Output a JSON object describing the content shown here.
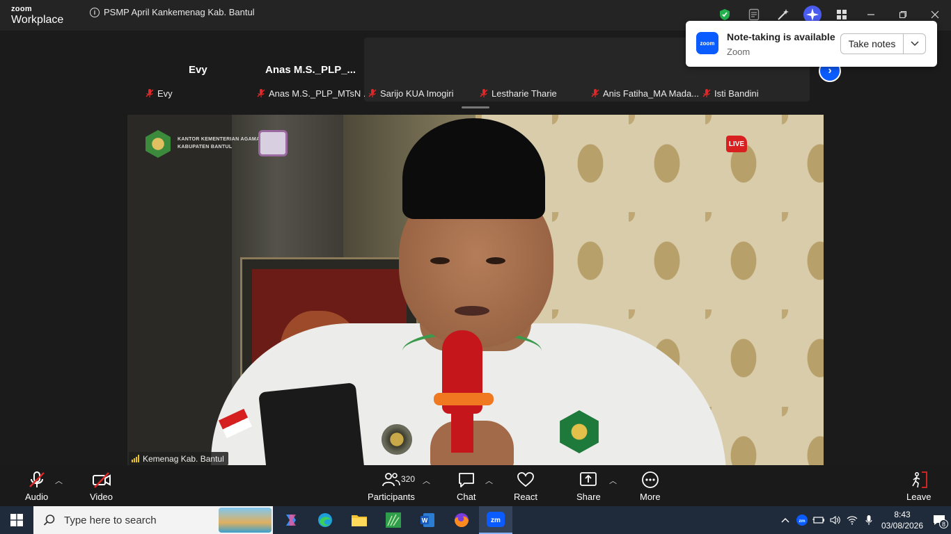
{
  "titlebar": {
    "brand_small": "zoom",
    "brand_large": "Workplace",
    "meeting_title": "PSMP April Kankemenag Kab. Bantul"
  },
  "gallery": {
    "names": [
      "Evy",
      "Anas  M.S._PLP_..."
    ],
    "tiles": [
      {
        "label": "Evy"
      },
      {
        "label": "Anas M.S._PLP_MTsN ..."
      },
      {
        "label": "Sarijo KUA Imogiri"
      },
      {
        "label": "Lestharie Tharie"
      },
      {
        "label": "Anis Fatiha_MA Mada..."
      },
      {
        "label": "Isti Bandini"
      }
    ]
  },
  "notification": {
    "title": "Note-taking is available",
    "subtitle": "Zoom",
    "logo_text": "zoom",
    "button_label": "Take notes"
  },
  "video": {
    "speaker_name": "Kemenag Kab. Bantul",
    "live_label": "LIVE",
    "org_text_line1": "KANTOR KEMENTERIAN AGAMA",
    "org_text_line2": "KABUPATEN BANTUL"
  },
  "toolbar": {
    "audio": "Audio",
    "video": "Video",
    "participants": "Participants",
    "participants_count": "320",
    "chat": "Chat",
    "react": "React",
    "share": "Share",
    "more": "More",
    "leave": "Leave"
  },
  "taskbar": {
    "search_placeholder": "Type here to search",
    "time": "8:43",
    "date": "03/08/2026",
    "notification_count": "8"
  },
  "colors": {
    "accent_blue": "#0b5cff",
    "mute_red": "#e02828",
    "leave_red": "#e02828",
    "taskbar_bg": "#1f2a3a"
  }
}
